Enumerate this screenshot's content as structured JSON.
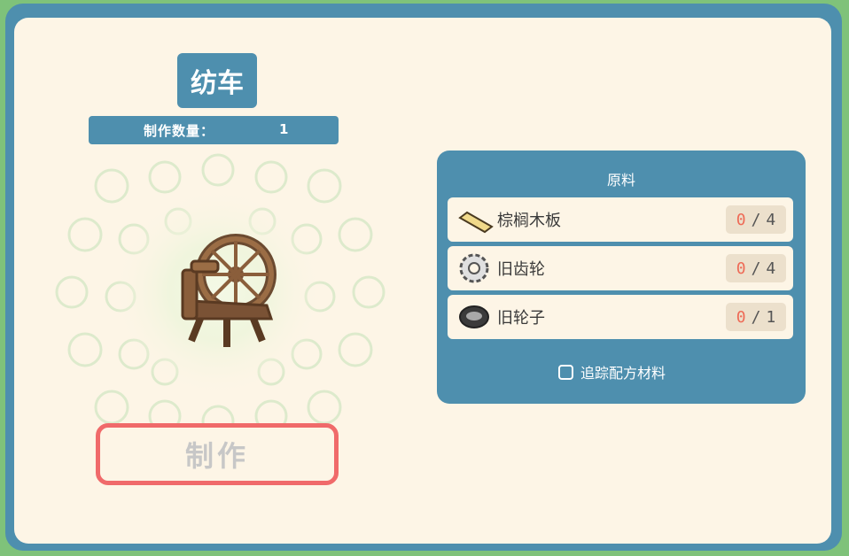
{
  "recipe": {
    "title": "纺车",
    "quantity_label": "制作数量：",
    "quantity_value": "1",
    "item_icon": "spinning-wheel",
    "craft_label": "制作"
  },
  "materials": {
    "header": "原料",
    "items": [
      {
        "name": "棕榈木板",
        "icon": "palm-plank",
        "have": "0",
        "sep": "/",
        "need": "4"
      },
      {
        "name": "旧齿轮",
        "icon": "old-gear",
        "have": "0",
        "sep": "/",
        "need": "4"
      },
      {
        "name": "旧轮子",
        "icon": "old-wheel",
        "have": "0",
        "sep": "/",
        "need": "1"
      }
    ],
    "track_label": "追踪配方材料",
    "track_checked": false
  },
  "colors": {
    "frame": "#4e8fae",
    "panel": "#fdf5e6",
    "craft_border": "#f06a6a",
    "have_count": "#ee6b57"
  }
}
